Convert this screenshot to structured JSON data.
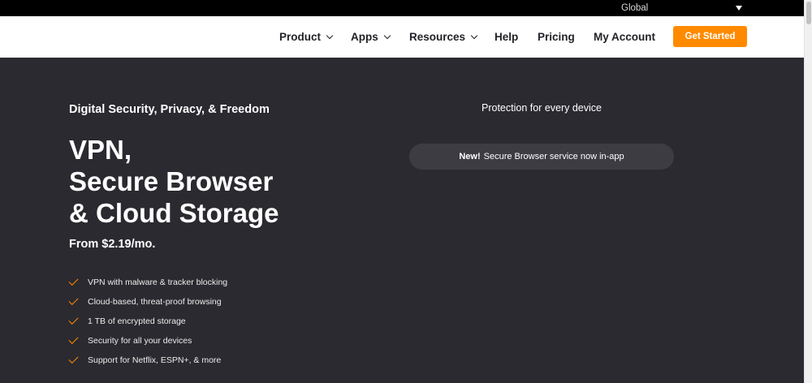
{
  "region": {
    "label": "Global"
  },
  "nav": {
    "product": "Product",
    "apps": "Apps",
    "resources": "Resources",
    "help": "Help",
    "pricing": "Pricing",
    "account": "My Account",
    "cta": "Get Started"
  },
  "hero": {
    "eyebrow": "Digital Security, Privacy, & Freedom",
    "headline": [
      "VPN,",
      "Secure Browser",
      "& Cloud Storage"
    ],
    "price": "From $2.19/mo.",
    "features": [
      "VPN with malware & tracker blocking",
      "Cloud-based, threat-proof browsing",
      "1 TB of encrypted storage",
      "Security for all your devices",
      "Support for Netflix, ESPN+, & more"
    ],
    "right_heading": "Protection for every device",
    "announcement": {
      "badge": "New!",
      "text": "Secure Browser service now in-app"
    }
  },
  "colors": {
    "accent": "#ff8a00",
    "hero_bg": "#2b2a30",
    "pill_bg": "#3d3c43"
  },
  "icons": {
    "region_caret": "caret-down-icon",
    "nav_chevron": "chevron-down-icon",
    "feature_check": "check-icon"
  }
}
